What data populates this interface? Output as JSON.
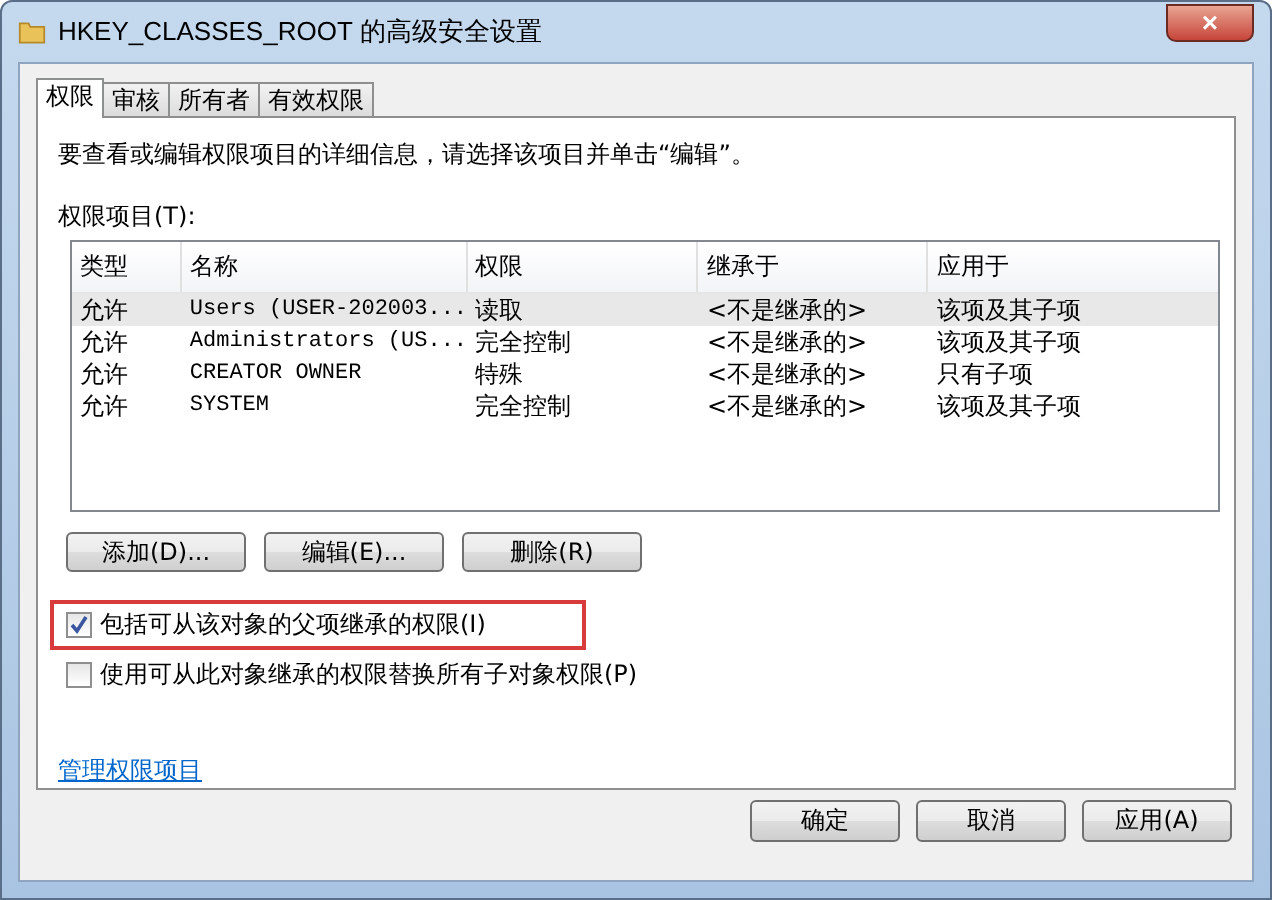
{
  "window": {
    "title": "HKEY_CLASSES_ROOT 的高级安全设置",
    "close": "×"
  },
  "tabs": [
    {
      "label": "权限",
      "selected": true
    },
    {
      "label": "审核",
      "selected": false
    },
    {
      "label": "所有者",
      "selected": false
    },
    {
      "label": "有效权限",
      "selected": false
    }
  ],
  "intro": "要查看或编辑权限项目的详细信息，请选择该项目并单击“编辑”。",
  "table": {
    "label": "权限项目(T):",
    "columns": [
      "类型",
      "名称",
      "权限",
      "继承于",
      "应用于"
    ],
    "rows": [
      {
        "cells": [
          "允许",
          "Users (USER-202003...",
          "读取",
          "<不是继承的>",
          "该项及其子项"
        ],
        "selected": true
      },
      {
        "cells": [
          "允许",
          "Administrators (US...",
          "完全控制",
          "<不是继承的>",
          "该项及其子项"
        ],
        "selected": false
      },
      {
        "cells": [
          "允许",
          "CREATOR OWNER",
          "特殊",
          "<不是继承的>",
          "只有子项"
        ],
        "selected": false
      },
      {
        "cells": [
          "允许",
          "SYSTEM",
          "完全控制",
          "<不是继承的>",
          "该项及其子项"
        ],
        "selected": false
      }
    ]
  },
  "row_buttons": [
    "添加(D)...",
    "编辑(E)...",
    "删除(R)"
  ],
  "options": [
    {
      "label": "包括可从该对象的父项继承的权限(I)",
      "checked": true,
      "highlighted": true
    },
    {
      "label": "使用可从此对象继承的权限替换所有子对象权限(P)",
      "checked": false,
      "highlighted": false
    }
  ],
  "link": "管理权限项目",
  "dialog_buttons": [
    "确定",
    "取消",
    "应用(A)"
  ]
}
